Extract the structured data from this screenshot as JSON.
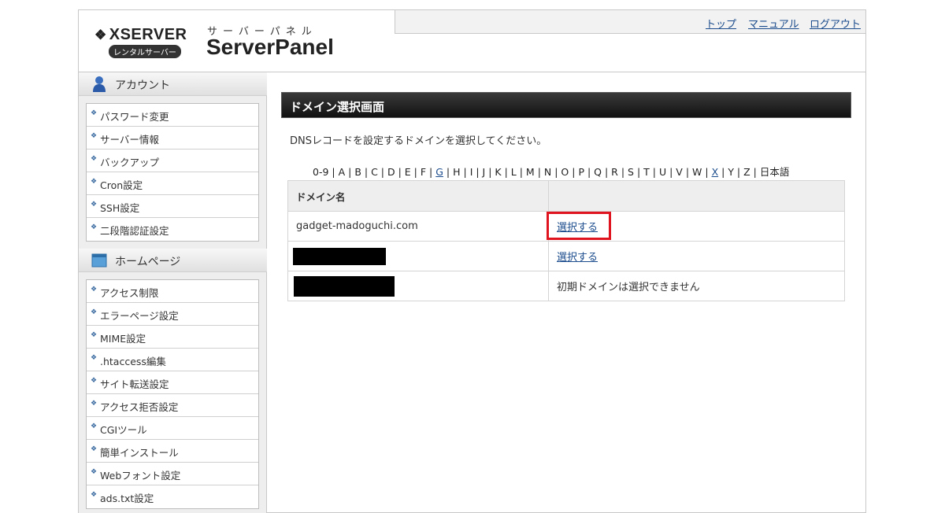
{
  "header": {
    "logo_text": "XSERVER",
    "logo_badge": "レンタルサーバー",
    "panel_kana": "サーバーパネル",
    "panel_name": "ServerPanel",
    "nav": [
      {
        "label": "トップ"
      },
      {
        "label": "マニュアル"
      },
      {
        "label": "ログアウト"
      }
    ]
  },
  "sidebar": {
    "account": {
      "title": "アカウント",
      "items": [
        "パスワード変更",
        "サーバー情報",
        "バックアップ",
        "Cron設定",
        "SSH設定",
        "二段階認証設定"
      ]
    },
    "homepage": {
      "title": "ホームページ",
      "items": [
        "アクセス制限",
        "エラーページ設定",
        "MIME設定",
        ".htaccess編集",
        "サイト転送設定",
        "アクセス拒否設定",
        "CGIツール",
        "簡単インストール",
        "Webフォント設定",
        "ads.txt設定"
      ]
    }
  },
  "main": {
    "title": "ドメイン選択画面",
    "intro": "DNSレコードを設定するドメインを選択してください。",
    "alphabet": [
      "0-9",
      "A",
      "B",
      "C",
      "D",
      "E",
      "F",
      "G",
      "H",
      "I",
      "J",
      "K",
      "L",
      "M",
      "N",
      "O",
      "P",
      "Q",
      "R",
      "S",
      "T",
      "U",
      "V",
      "W",
      "X",
      "Y",
      "Z",
      "日本語"
    ],
    "alphabet_links": [
      "G",
      "X"
    ],
    "table": {
      "header": "ドメイン名",
      "rows": [
        {
          "domain": "gadget-madoguchi.com",
          "action": "選択する",
          "action_is_link": true
        },
        {
          "domain": "",
          "action": "選択する",
          "action_is_link": true
        },
        {
          "domain": "",
          "action": "初期ドメインは選択できません",
          "action_is_link": false
        }
      ]
    }
  },
  "colors": {
    "link": "#1a4b8c",
    "title_bar": "#1a1a1a",
    "highlight": "#e0141e"
  }
}
